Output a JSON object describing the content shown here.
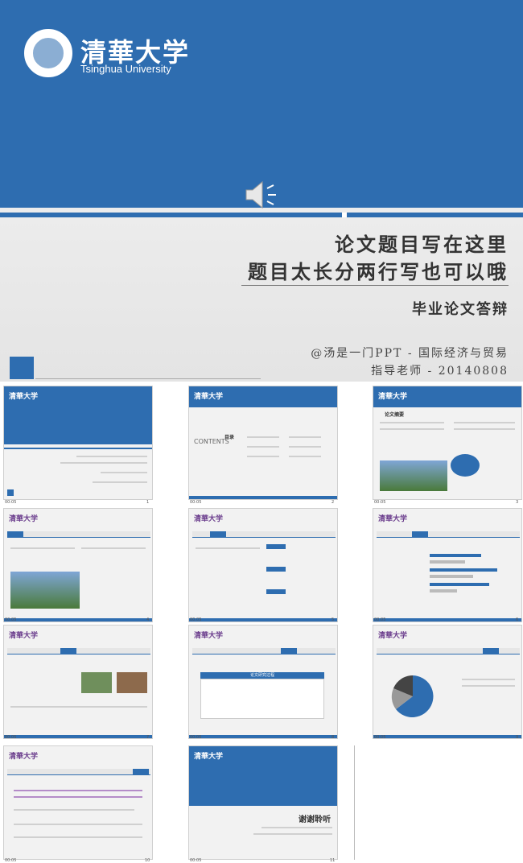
{
  "main": {
    "logo_cn": "清華大学",
    "logo_en": "Tsinghua University",
    "title_line1": "论文题目写在这里",
    "title_line2": "题目太长分两行写也可以哦",
    "subtitle": "毕业论文答辩",
    "author": "@汤是一门PPT - 国际经济与贸易",
    "advisor": "指导老师 - 20140808",
    "colors": {
      "accent": "#2e6db0",
      "background": "#efefef"
    },
    "icons": [
      "speaker-icon",
      "tsinghua-seal-icon"
    ]
  },
  "thumbnails": [
    {
      "index": "1",
      "time": "00:05"
    },
    {
      "index": "2",
      "time": "00:05",
      "contents_label": "CONTENTS",
      "contents_cn": "目录"
    },
    {
      "index": "3",
      "time": "00:05",
      "heading": "论文摘要"
    },
    {
      "index": "4",
      "time": "00:05"
    },
    {
      "index": "5",
      "time": "00:05"
    },
    {
      "index": "6",
      "time": "00:05"
    },
    {
      "index": "7",
      "time": "00:05"
    },
    {
      "index": "8",
      "time": "00:05",
      "table_title": "论文研究过程"
    },
    {
      "index": "9",
      "time": "00:05"
    },
    {
      "index": "10",
      "time": "00:05"
    },
    {
      "index": "11",
      "time": "00:05",
      "thanks": "谢谢聆听"
    }
  ]
}
